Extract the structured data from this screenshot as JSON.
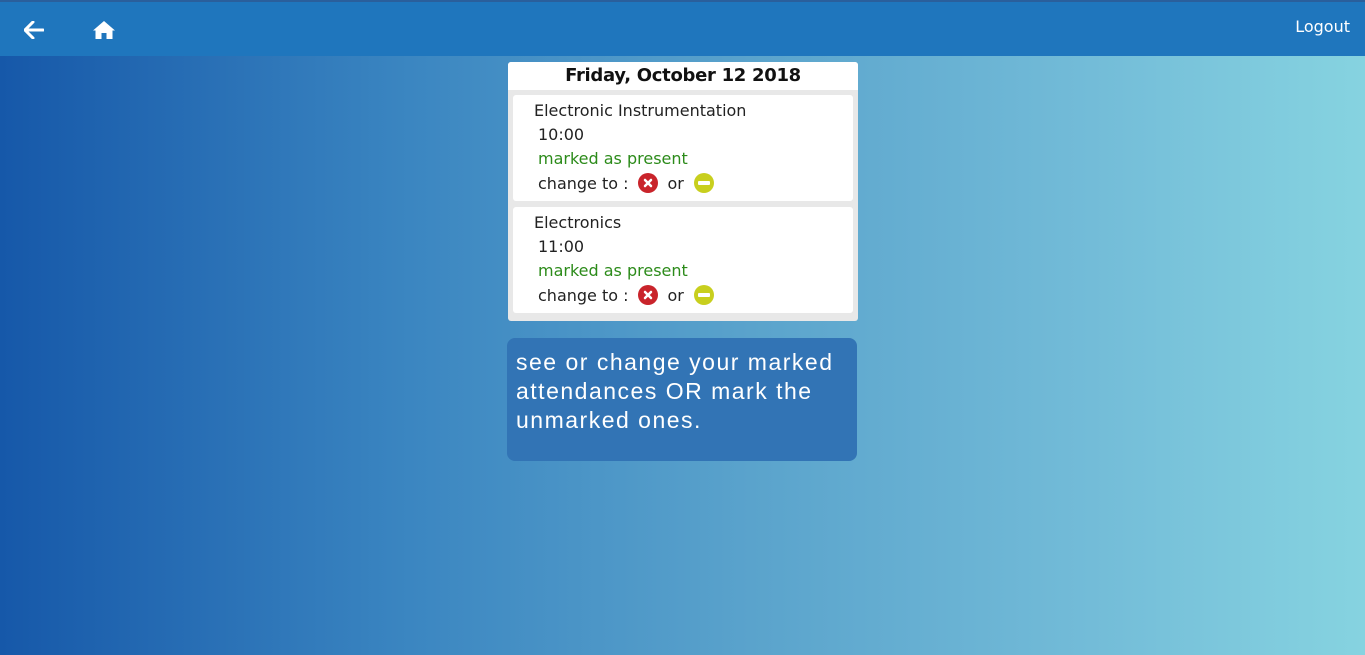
{
  "header": {
    "back_icon": "arrow-left-icon",
    "home_icon": "home-icon",
    "logout_label": "Logout"
  },
  "card": {
    "date_title": "Friday, October 12 2018",
    "entries": [
      {
        "subject": "Electronic Instrumentation",
        "time": "10:00",
        "status": "marked as present",
        "change_label": "change to :",
        "or_label": "or"
      },
      {
        "subject": "Electronics",
        "time": "11:00",
        "status": "marked as present",
        "change_label": "change to :",
        "or_label": "or"
      }
    ]
  },
  "info": {
    "text": "see or change your marked attendances OR mark the unmarked ones."
  },
  "colors": {
    "status_present": "#2c8b1a",
    "absent_button": "#c9242b",
    "excused_button": "#c8cf1e",
    "topbar": "#1f76bd",
    "info_box": "#3274b5"
  }
}
